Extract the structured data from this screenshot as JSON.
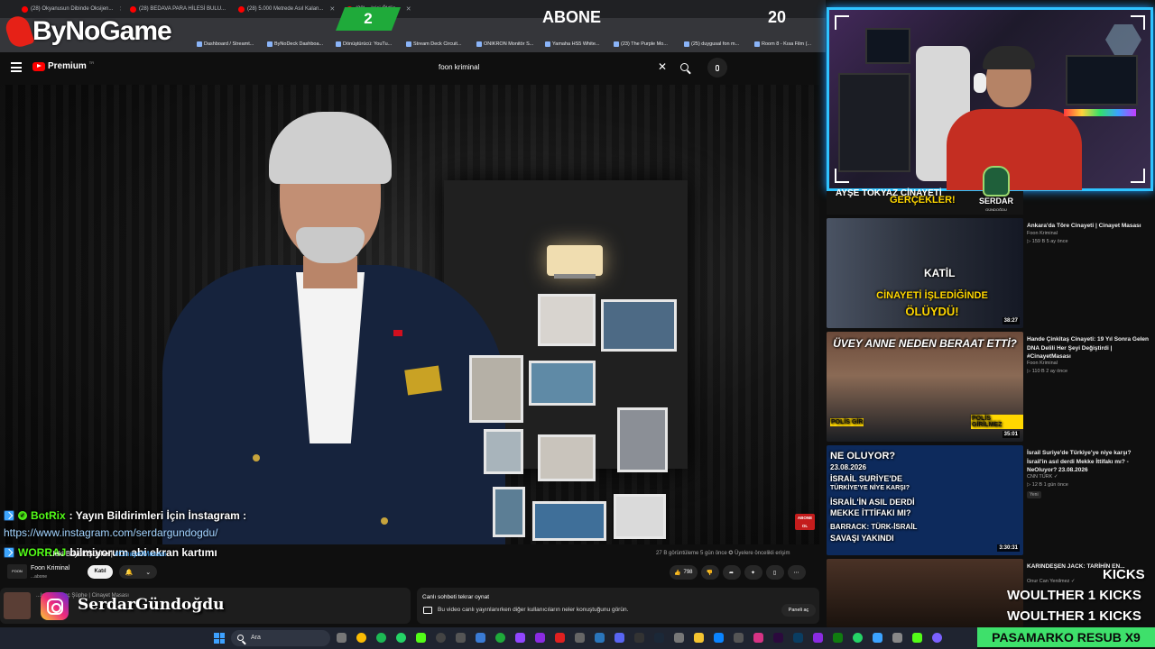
{
  "browser": {
    "tabs": [
      {
        "label": "(28) Okyanusun Dibinde Oksijen..."
      },
      {
        "label": "(28) BEDAVA PARA HİLESİ BULU..."
      },
      {
        "label": "(28) 5.000 Metrede Asıl Kalan..."
      },
      {
        "label": "(28) ...lgisi Öldür..."
      }
    ],
    "bookmarks": [
      {
        "label": "Dashboard / Streamt..."
      },
      {
        "label": "ByNoDeck Dashboa..."
      },
      {
        "label": "Dönüştürücü: YouTu..."
      },
      {
        "label": "Stream Deck Circuit..."
      },
      {
        "label": "ONIKRON Monitör S..."
      },
      {
        "label": "Yamaha HS5 White..."
      },
      {
        "label": "(23) The Purple Mo..."
      },
      {
        "label": "(25) duygusal fon m..."
      },
      {
        "label": "Room 8 - Kısa Film (..."
      }
    ]
  },
  "overlay": {
    "brand": "ByNoGame",
    "sub_goal": {
      "current": "2",
      "label": "ABONE",
      "target": "20"
    },
    "chat": [
      {
        "user": "BotRix",
        "message": ": Yayın Bildirimleri İçin İnstagram :",
        "link": "https://www.instagram.com/serdargundogdu/"
      },
      {
        "user": "WORRAJ",
        "message": "bilmiyorum abi ekran kartımı"
      }
    ],
    "instagram_handle": "SerdarGündoğdu",
    "streamer_badge": {
      "name": "SERDAR",
      "sub": "GÜNDOĞDU"
    },
    "kicks": [
      {
        "text": "KICKS"
      },
      {
        "text": "WOULTHER  1 KICKS"
      },
      {
        "text": "WOULTHER  1 KICKS"
      }
    ],
    "bottom_banner": "PASAMARKO  RESUB X9"
  },
  "youtube": {
    "logo_label": "Premium",
    "logo_sup": "TR",
    "search": {
      "value": "foon kriminal",
      "clear": "✕"
    },
    "video": {
      "title_prefix": "...leki Büyük Şüphe | ",
      "title_hashtag": "#CinayetMasası",
      "stats": "27 B görüntüleme  5 gün önce  ✪ Üyelere öncelikli erişim",
      "badge": "ABONE OL"
    },
    "channel": {
      "name": "Foon Kriminal",
      "subs": "...abone",
      "avatar_label": "FOON",
      "join_label": "Katıl"
    },
    "actions": {
      "likes": "798"
    },
    "description_snippet": "...leki Korkunç Şüphe | Cinayet Masası",
    "live_chat": {
      "title": "Canlı sohbeti tekrar oynat",
      "desc": "Bu video canlı yayınlanırken diğer kullanıcıların neler konuştuğunu görün.",
      "button": "Paneli aç"
    },
    "recommendations": [
      {
        "title": "Ankara'da Töre Cinayeti | Cinayet Masası",
        "channel": "Foon Kriminal",
        "meta": "▷ 159 B  5 ay önce",
        "duration": "38:27",
        "thumb_lines": [
          "KATİL",
          "CİNAYETİ İŞLEDİĞİNDE",
          "ÖLÜYDÜ!"
        ]
      },
      {
        "title": "Hande Çinkitaş Cinayeti: 19 Yıl Sonra Gelen DNA Delili Her Şeyi Değiştirdi | #CinayetMasası",
        "channel": "Foon Kriminal",
        "meta": "▷ 110 B  2 ay önce",
        "duration": "35:01",
        "thumb_lines": [
          "ÜVEY ANNE NEDEN BERAAT ETTİ?",
          "POLİS GİRİLMEZ",
          "POLİS GİR"
        ]
      },
      {
        "title": "İsrail Suriye'de Türkiye'ye niye karşı? İsrail'in asıl derdi Mekke İttifakı mı? - NeOluyor? 23.08.2026",
        "channel": "CNN TÜRK ✓",
        "meta": "▷ 12 B  1 gün önce",
        "badge": "Yeni",
        "duration": "3:30:31",
        "thumb_lines": [
          "NE OLUYOR?",
          "23.08.2026",
          "İSRAİL SURİYE'DE",
          "TÜRKİYE'YE NİYE KARŞI?",
          "İSRAİL'İN ASIL DERDİ",
          "MEKKE İTTİFAKI MI?",
          "BARRACK: TÜRK-İSRAİL",
          "SAVAŞI YAKINDI"
        ]
      },
      {
        "title": "KARINDEŞEN JACK: TARİHİN EN...",
        "channel": "Onur Can Yenilmez ✓",
        "meta": "",
        "duration": "",
        "thumb_lines": []
      }
    ],
    "top_thumb": {
      "line1": "AYŞE TOKYAZ CİNAYETİ",
      "line2": "GERÇEKLER!"
    }
  },
  "taskbar": {
    "search_placeholder": "Ara"
  },
  "colors": {
    "accent_green": "#3ee06b",
    "webcam_border": "#2fc3ff",
    "youtube_red": "#ff0000",
    "kick_green": "#53fc18"
  }
}
